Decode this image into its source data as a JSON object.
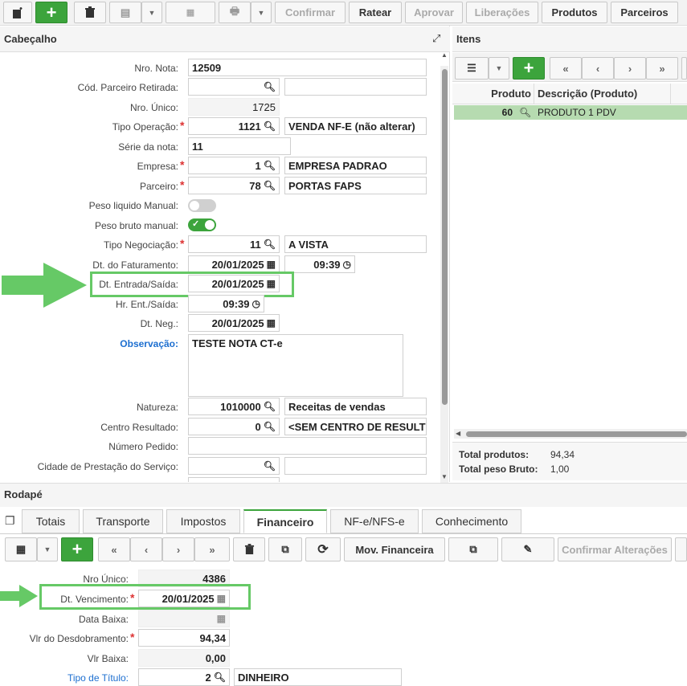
{
  "toolbar": {
    "confirm": "Confirmar",
    "ratear": "Ratear",
    "aprovar": "Aprovar",
    "liberacoes": "Liberações",
    "produtos": "Produtos",
    "parceiros": "Parceiros"
  },
  "cabecalho": {
    "title": "Cabeçalho",
    "fields": {
      "nro_nota": {
        "label": "Nro. Nota:",
        "value": "12509"
      },
      "cod_parceiro": {
        "label": "Cód. Parceiro Retirada:",
        "value": "",
        "desc": ""
      },
      "nro_unico": {
        "label": "Nro. Único:",
        "value": "1725"
      },
      "tipo_operacao": {
        "label": "Tipo Operação:",
        "value": "1121",
        "desc": "VENDA NF-E (não alterar)"
      },
      "serie": {
        "label": "Série da nota:",
        "value": "11"
      },
      "empresa": {
        "label": "Empresa:",
        "value": "1",
        "desc": "EMPRESA PADRAO"
      },
      "parceiro": {
        "label": "Parceiro:",
        "value": "78",
        "desc": "PORTAS FAPS"
      },
      "peso_liquido": {
        "label": "Peso liquido Manual:"
      },
      "peso_bruto": {
        "label": "Peso bruto manual:"
      },
      "tipo_negociacao": {
        "label": "Tipo Negociação:",
        "value": "11",
        "desc": "A VISTA"
      },
      "dt_faturamento": {
        "label": "Dt. do Faturamento:",
        "value": "20/01/2025",
        "time": "09:39"
      },
      "dt_entrada": {
        "label": "Dt. Entrada/Saída:",
        "value": "20/01/2025"
      },
      "hr_ent": {
        "label": "Hr. Ent./Saída:",
        "value": "09:39"
      },
      "dt_neg": {
        "label": "Dt. Neg.:",
        "value": "20/01/2025"
      },
      "observacao": {
        "label": "Observação:",
        "value": "TESTE NOTA CT-e"
      },
      "natureza": {
        "label": "Natureza:",
        "value": "1010000",
        "desc": "Receitas de vendas"
      },
      "centro_resultado": {
        "label": "Centro Resultado:",
        "value": "0",
        "desc": "<SEM CENTRO DE RESULT"
      },
      "numero_pedido": {
        "label": "Número Pedido:",
        "value": ""
      },
      "cidade": {
        "label": "Cidade de Prestação do Serviço:",
        "value": "",
        "desc": ""
      }
    }
  },
  "itens": {
    "title": "Itens",
    "columns": [
      "Produto",
      "Descrição (Produto)"
    ],
    "rows": [
      {
        "produto": "60",
        "descricao": "PRODUTO 1 PDV"
      }
    ],
    "total_produtos_label": "Total produtos:",
    "total_produtos": "94,34",
    "total_peso_label": "Total peso Bruto:",
    "total_peso": "1,00"
  },
  "rodape": {
    "title": "Rodapé",
    "tabs": [
      "Totais",
      "Transporte",
      "Impostos",
      "Financeiro",
      "NF-e/NFS-e",
      "Conhecimento"
    ],
    "active_tab": "Financeiro",
    "buttons": {
      "mov_financeira": "Mov. Financeira",
      "confirmar_alteracoes": "Confirmar Alterações"
    },
    "fields": {
      "nro_unico": {
        "label": "Nro Único:",
        "value": "4386"
      },
      "dt_vencimento": {
        "label": "Dt. Vencimento:",
        "value": "20/01/2025"
      },
      "data_baixa": {
        "label": "Data Baixa:",
        "value": ""
      },
      "vlr_desdobramento": {
        "label": "Vlr do Desdobramento:",
        "value": "94,34"
      },
      "vlr_baixa": {
        "label": "Vlr Baixa:",
        "value": "0,00"
      },
      "tipo_titulo": {
        "label": "Tipo de Título:",
        "value": "2",
        "desc": "DINHEIRO"
      }
    }
  },
  "colors": {
    "accent": "#3ca43c",
    "highlight": "#66c966",
    "link": "#1d6fd0",
    "required": "#d33"
  }
}
